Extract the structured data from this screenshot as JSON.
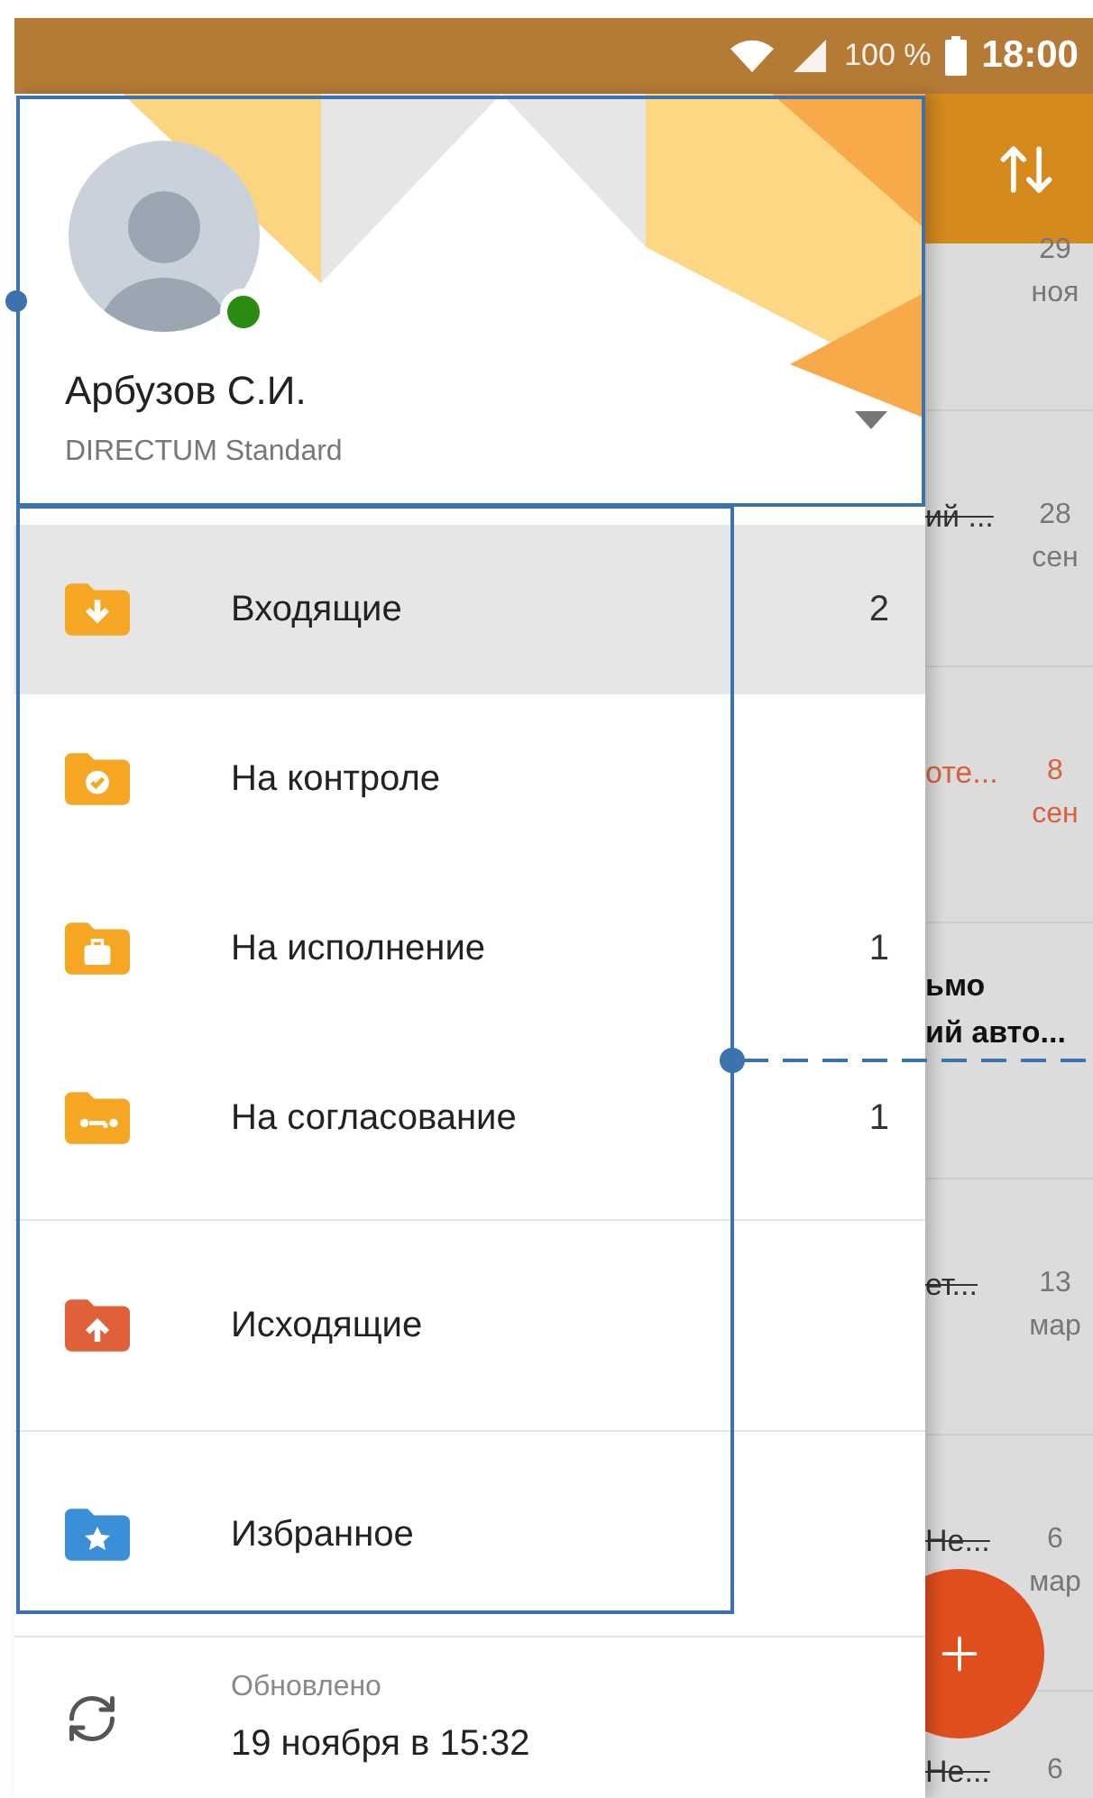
{
  "status_bar": {
    "battery": "100 %",
    "time": "18:00"
  },
  "profile": {
    "name": "Арбузов С.И.",
    "account": "DIRECTUM Standard",
    "online": true
  },
  "menu_groups": [
    [
      {
        "label": "Входящие",
        "count": "2",
        "kind": "inbox",
        "color": "#f5a623",
        "selected": true
      },
      {
        "label": "На контроле",
        "kind": "check",
        "color": "#f5a623",
        "selected": false
      },
      {
        "label": "На исполнение",
        "count": "1",
        "kind": "briefcase",
        "color": "#f5a623",
        "selected": false
      },
      {
        "label": "На согласование",
        "count": "1",
        "kind": "key",
        "color": "#f5a623",
        "selected": false
      }
    ],
    [
      {
        "label": "Исходящие",
        "kind": "upload",
        "color": "#e0603a",
        "selected": false
      }
    ],
    [
      {
        "label": "Избранное",
        "kind": "star",
        "color": "#3b8fd9",
        "selected": false
      }
    ]
  ],
  "updated": {
    "label": "Обновлено",
    "time": "19 ноября в 15:32"
  },
  "background_list": [
    {
      "day": "29",
      "month": "ноя",
      "kind": "plain"
    },
    {
      "title": "ий ...",
      "day": "28",
      "month": "сен",
      "kind": "done"
    },
    {
      "title": "оте...",
      "day": "8",
      "month": "сен",
      "kind": "overdue"
    },
    {
      "title": "ьмо",
      "title_2": "ий авто...",
      "kind": "unread"
    },
    {
      "title": "ет...",
      "day": "13",
      "month": "мар",
      "kind": "done"
    },
    {
      "title": "Не...",
      "day": "6",
      "month": "мар",
      "kind": "done"
    },
    {
      "title": "Не...",
      "day": "6",
      "kind": "done"
    }
  ]
}
